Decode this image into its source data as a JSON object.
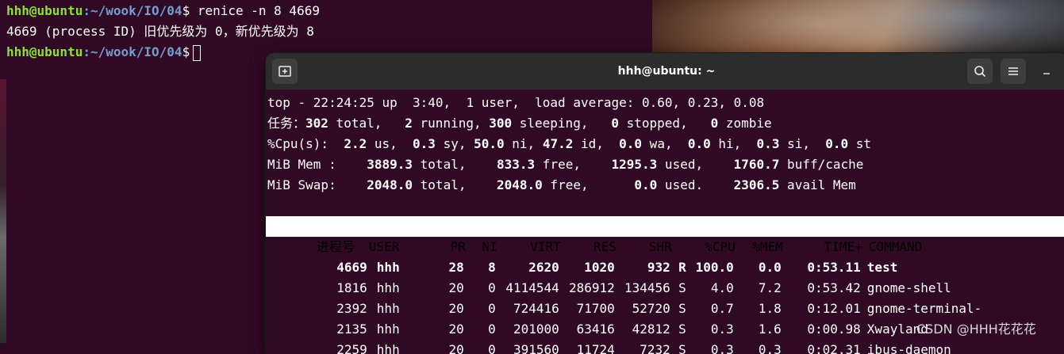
{
  "background_terminal": {
    "prompt_user": "hhh@ubuntu",
    "prompt_path": ":~/wook/IO/04",
    "prompt_symbol": "$",
    "command": " renice -n 8 4669",
    "output": "4669 (process ID) 旧优先级为 0，新优先级为 8"
  },
  "window": {
    "title": "hhh@ubuntu: ~",
    "new_tab_icon": "new-tab-icon",
    "search_icon": "search-icon",
    "menu_icon": "hamburger-menu-icon",
    "minimize_icon": "minimize-icon"
  },
  "top": {
    "summary": {
      "line1": "top - 22:24:25 up  3:40,  1 user,  load average: 0.60, 0.23, 0.08",
      "tasks": {
        "label": "任务：",
        "total": "302",
        "total_label": " total,   ",
        "running": "2",
        "running_label": " running, ",
        "sleeping": "300",
        "sleeping_label": " sleeping,   ",
        "stopped": "0",
        "stopped_label": " stopped,   ",
        "zombie": "0",
        "zombie_label": " zombie"
      },
      "cpu": {
        "label": "%Cpu(s):  ",
        "us": "2.2",
        "us_label": " us,  ",
        "sy": "0.3",
        "sy_label": " sy, ",
        "ni": "50.0",
        "ni_label": " ni, ",
        "id": "47.2",
        "id_label": " id,  ",
        "wa": "0.0",
        "wa_label": " wa,  ",
        "hi": "0.0",
        "hi_label": " hi,  ",
        "si": "0.3",
        "si_label": " si,  ",
        "st": "0.0",
        "st_label": " st"
      },
      "mem": {
        "label": "MiB Mem :    ",
        "total": "3889.3",
        "total_label": " total,    ",
        "free": "833.3",
        "free_label": " free,    ",
        "used": "1295.3",
        "used_label": " used,    ",
        "buff": "1760.7",
        "buff_label": " buff/cache"
      },
      "swap": {
        "label": "MiB Swap:    ",
        "total": "2048.0",
        "total_label": " total,    ",
        "free": "2048.0",
        "free_label": " free,      ",
        "used": "0.0",
        "used_label": " used.    ",
        "avail": "2306.5",
        "avail_label": " avail Mem"
      }
    },
    "columns": [
      "进程号",
      "USER",
      "PR",
      "NI",
      "VIRT",
      "RES",
      "SHR",
      "",
      "%CPU",
      "%MEM",
      "TIME+",
      "COMMAND"
    ],
    "processes": [
      {
        "pid": "4669",
        "user": "hhh",
        "pr": "28",
        "ni": "8",
        "virt": "2620",
        "res": "1020",
        "shr": "932",
        "s": "R",
        "cpu": "100.0",
        "mem": "0.0",
        "time": "0:53.11",
        "command": "test",
        "highlight": true
      },
      {
        "pid": "1816",
        "user": "hhh",
        "pr": "20",
        "ni": "0",
        "virt": "4114544",
        "res": "286912",
        "shr": "134456",
        "s": "S",
        "cpu": "4.0",
        "mem": "7.2",
        "time": "0:53.42",
        "command": "gnome-shell",
        "highlight": false
      },
      {
        "pid": "2392",
        "user": "hhh",
        "pr": "20",
        "ni": "0",
        "virt": "724416",
        "res": "71700",
        "shr": "52720",
        "s": "S",
        "cpu": "0.7",
        "mem": "1.8",
        "time": "0:12.01",
        "command": "gnome-terminal-",
        "highlight": false
      },
      {
        "pid": "2135",
        "user": "hhh",
        "pr": "20",
        "ni": "0",
        "virt": "201000",
        "res": "63416",
        "shr": "42812",
        "s": "S",
        "cpu": "0.3",
        "mem": "1.6",
        "time": "0:00.98",
        "command": "Xwayland",
        "highlight": false
      },
      {
        "pid": "2259",
        "user": "hhh",
        "pr": "20",
        "ni": "0",
        "virt": "391560",
        "res": "11724",
        "shr": "7232",
        "s": "S",
        "cpu": "0.3",
        "mem": "0.3",
        "time": "0:02.31",
        "command": "ibus-daemon",
        "highlight": false
      }
    ]
  },
  "watermark": "CSDN @HHH花花花"
}
